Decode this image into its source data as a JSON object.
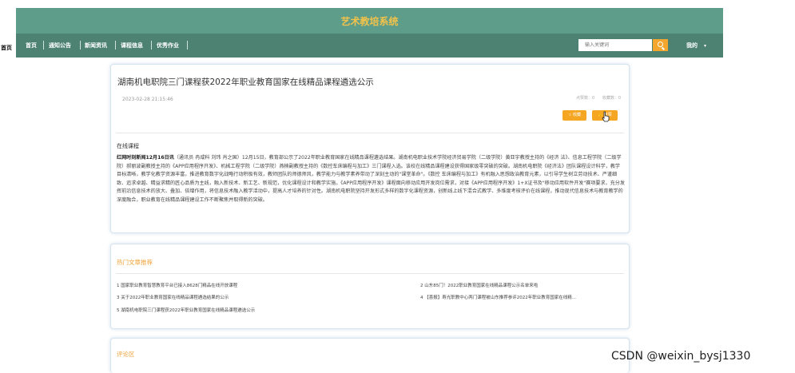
{
  "header": {
    "site_title": "艺术教培系统"
  },
  "nav": {
    "overlay_label": "首页",
    "items": [
      "首页",
      "通知公告",
      "新闻资讯",
      "课程信息",
      "优秀作业"
    ],
    "search_placeholder": "输入关键词",
    "user_label": "我的",
    "user_chevron": "▾"
  },
  "article": {
    "title": "湖南机电职院三门课程获2022年职业教育国家在线精品课程遴选公示",
    "date": "2023-02-28 21:15:46",
    "stats": [
      "点赞数：0",
      "收藏数：0"
    ],
    "collect_label": "☆ 收藏",
    "like_label": "👍 点赞",
    "category": "在线课程",
    "lead": "红网时刻新闻12月16日讯",
    "body": "（通讯员 冉咸科 刘玮 肖之国）12月15日，教育部公示了2022年职业教育国家在线精品课程遴选结果。湖南机电职业技术学院经济贸易学院（二级学院）黄亚宇教授主持的《经济 法》、信息工程学院（二级学院）郝丽波副教授主持的《APP应用程序开发》、机械工程学院（二级学院）燕楠副教授主持的《数控车床编程与加工》三门课程入选。该校在线精品课程建设获得国家级零突破的突破。湖南机电职院《经济法》团队课程设计科学，教学目标清晰，教学化教学资源丰富，推进教育数字化战略行动积极有效，教师团队的师德师风，教学能力与教学素养带动了深刻主动的\"课堂革命\"。《数控 车床编程与加工》有机融入思想政治教育元素，以引导学生树立劳动技术、严谨细致、追求卓越、精益求精的匠心品质为主线，融入新技术、新工艺、新规范，优化课程设计和教学实施。《APP应用程序开发》课程面向移动应用开发岗位需求，对接《APP应用程序开发》1+X证书及\"移动应用软件开发\"赛项要求，充分发挥前沿信息技术的放大、叠加、倍增作用，将信息技术融入教学活动中，提高人才培养的针对性。湖南机电职院坚持开发形式多样的数字化课程资源，创新线上线下混合式教学、多维度考核评价在线课程，推动现代信息技术与教育教学的深度融合，职业教育在线精品课程建设工作不断聚焦并取得新的突破。"
  },
  "hot": {
    "title": "热门文章推荐",
    "items": [
      "1 国家职业教育智慧教育平台已接入8628门精品在线开放课程",
      "2 山东85门！2022职业教育国家在线精品课程公示名单来啦",
      "3 关于2022年职业教育国家在线精品课程遴选结果的公示",
      "4 【喜报】寿光职教中心两门课程被山东推荐参评2022年职业教育国家在线精...",
      "5 湖南机电职院三门课程获2022年职业教育国家在线精品课程遴选公示"
    ]
  },
  "comments": {
    "title": "评论区"
  },
  "watermark": "CSDN @weixin_bysj1330",
  "colors": {
    "title_bar": "#5e9d8a",
    "nav_bar": "#4d8273",
    "accent": "#f5a623",
    "site_title": "#f2c24a"
  }
}
